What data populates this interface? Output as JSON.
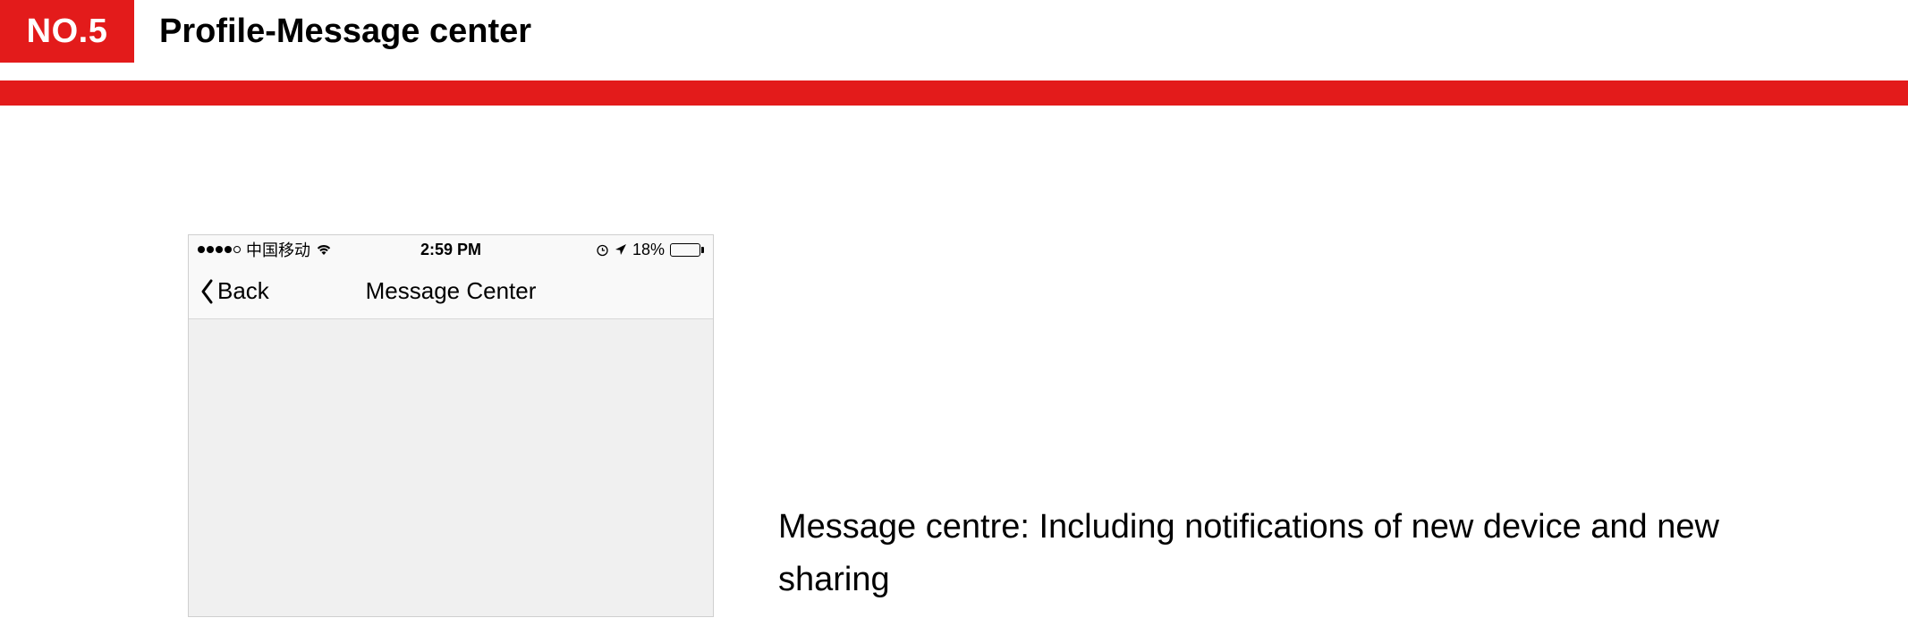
{
  "header": {
    "badge": "NO.5",
    "title": "Profile-Message center"
  },
  "phone": {
    "statusBar": {
      "carrier": "中国移动",
      "time": "2:59 PM",
      "batteryPercent": "18%"
    },
    "navBar": {
      "backLabel": "Back",
      "title": "Message Center"
    }
  },
  "description": "Message centre: Including notifications of new device and new sharing"
}
